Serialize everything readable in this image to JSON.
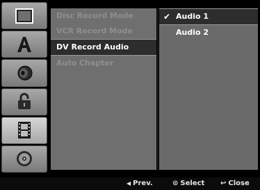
{
  "sidebar": {
    "tabs": [
      {
        "icon": "screen-icon",
        "active": false
      },
      {
        "icon": "letter-a-icon",
        "active": false
      },
      {
        "icon": "speaker-icon",
        "active": false
      },
      {
        "icon": "lock-icon",
        "active": false
      },
      {
        "icon": "film-icon",
        "active": true
      },
      {
        "icon": "disc-icon",
        "active": false
      }
    ]
  },
  "menu": {
    "items": [
      {
        "label": "Disc Record Mode"
      },
      {
        "label": "VCR Record Mode"
      },
      {
        "label": "DV Record Audio"
      },
      {
        "label": "Auto Chapter"
      }
    ],
    "selected_index": 2
  },
  "options": {
    "items": [
      {
        "label": "Audio 1",
        "checked": true
      },
      {
        "label": "Audio 2",
        "checked": false
      }
    ],
    "selected_index": 0
  },
  "footer": {
    "prev_label": "Prev.",
    "select_label": "Select",
    "close_label": "Close"
  },
  "colors": {
    "menu_bg": "#6f6f6f",
    "selected_bg": "#2d2d2d",
    "text_white": "#ffffff",
    "text_dim": "#8e8e8e"
  }
}
